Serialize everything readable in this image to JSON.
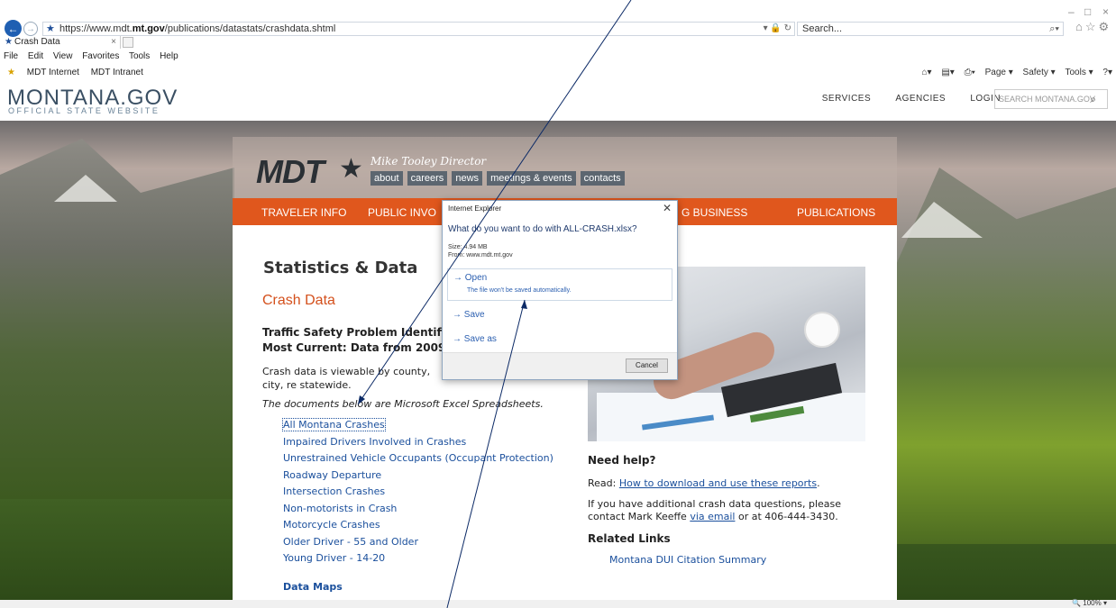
{
  "browser": {
    "url_prefix": "https://www.mdt.",
    "url_domain": "mt.gov",
    "url_path": "/publications/datastats/crashdata.shtml",
    "search_placeholder": "Search...",
    "tab_title": "Crash Data",
    "menu": [
      "File",
      "Edit",
      "View",
      "Favorites",
      "Tools",
      "Help"
    ],
    "favorites": [
      "MDT Internet",
      "MDT Intranet"
    ],
    "commands": [
      "Page ▾",
      "Safety ▾",
      "Tools ▾"
    ],
    "zoom": "100%"
  },
  "montana": {
    "logo": "MONTANA.GOV",
    "sub": "OFFICIAL STATE WEBSITE",
    "nav": [
      "SERVICES",
      "AGENCIES",
      "LOGIN"
    ],
    "search_placeholder": "SEARCH MONTANA.GOV"
  },
  "mdt": {
    "logo": "MDT",
    "director": "Mike Tooley Director",
    "links": [
      "about",
      "careers",
      "news",
      "meetings & events",
      "contacts"
    ],
    "nav": [
      "TRAVELER INFO",
      "PUBLIC INVO",
      "G BUSINESS",
      "PUBLICATIONS"
    ]
  },
  "content": {
    "heading": "Statistics & Data",
    "subheading": "Crash Data",
    "traffic_line1": "Traffic Safety Problem Identificati",
    "traffic_line2": "Most Current: Data from 2009-201",
    "viewable": "Crash data is viewable by county, city, re statewide.",
    "documents": "The documents below are Microsoft Excel Spreadsheets.",
    "links": [
      "All Montana Crashes",
      "Impaired Drivers Involved in Crashes",
      "Unrestrained Vehicle Occupants (Occupant Protection)",
      "Roadway Departure",
      "Intersection Crashes",
      "Non-motorists in Crash",
      "Motorcycle Crashes",
      "Older Driver - 55 and Older",
      "Young Driver - 14-20"
    ],
    "data_maps": "Data Maps",
    "need_help": "Need help?",
    "read_prefix": "Read: ",
    "read_link": "How to download and use these reports",
    "read_suffix": ".",
    "contact_prefix": "If you have additional crash data questions, please contact Mark Keeffe ",
    "contact_link": "via email",
    "contact_suffix": " or at 406-444-3430.",
    "related": "Related Links",
    "dui": "Montana DUI Citation Summary"
  },
  "dialog": {
    "title": "Internet Explorer",
    "question": "What do you want to do with ALL-CRASH.xlsx?",
    "size": "Size: 4.94 MB",
    "from": "From: www.mdt.mt.gov",
    "open": "Open",
    "open_sub": "The file won't be saved automatically.",
    "save": "Save",
    "save_as": "Save as",
    "cancel": "Cancel"
  }
}
